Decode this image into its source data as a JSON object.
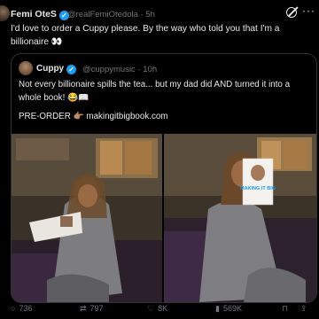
{
  "tweet": {
    "author_name": "Femi OteS",
    "handle": "@realFemiOtedola",
    "time": "5h",
    "text": "I'd love to order a Cuppy please. By the way who told you that I'm a billionaire 👀"
  },
  "quote": {
    "author_name": "Cuppy",
    "handle": "@cuppymusic",
    "time": "10h",
    "text": "Not every billionaire spills the tea... but my dad did AND turned it into a whole book! 😂📖",
    "cta": "PRE-ORDER 👉🏽 makingitbigbook.com"
  },
  "book_cover_text": "MAKING IT BIG",
  "actions": {
    "replies": "736",
    "reposts": "797",
    "likes": "8K",
    "views": "569K"
  },
  "icons": {
    "verified": "verified-badge-icon",
    "grok": "grok-icon",
    "more": "more-icon",
    "reply": "reply-icon",
    "repost": "repost-icon",
    "like": "heart-icon",
    "views": "views-icon",
    "bookmark": "bookmark-icon",
    "share": "share-icon"
  },
  "colors": {
    "background": "#000000",
    "text": "#e7e9ea",
    "muted": "#71767b",
    "verified": "#1d9bf0",
    "border": "#2f3336"
  }
}
